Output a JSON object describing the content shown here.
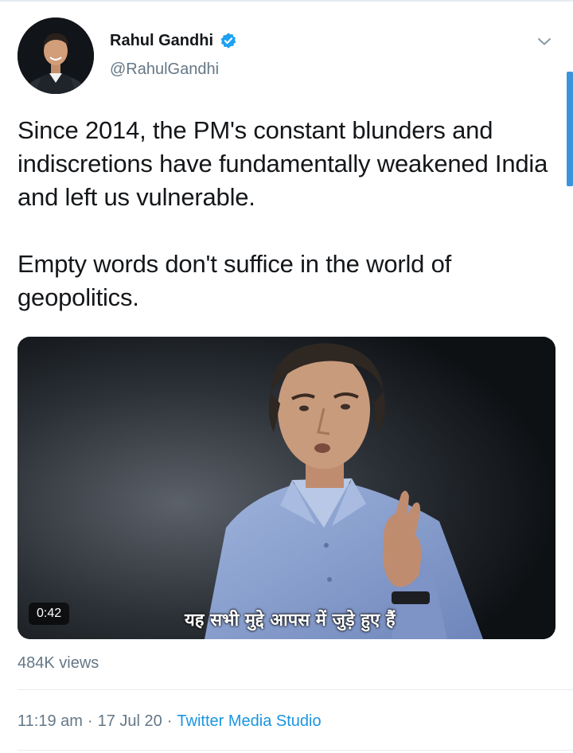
{
  "tweet": {
    "author": {
      "display_name": "Rahul Gandhi",
      "handle": "@RahulGandhi",
      "verified": true
    },
    "text_paragraphs": [
      "Since 2014, the PM's constant blunders and indiscretions have fundamentally weakened India and left us vulnerable.",
      "Empty words don't suffice in the world of geopolitics."
    ],
    "media": {
      "type": "video",
      "duration": "0:42",
      "subtitle": "यह सभी मुद्दे आपस में जुड़े हुए हैं"
    },
    "views": "484K views",
    "time": "11:19 am",
    "date": "17 Jul 20",
    "separator": "·",
    "source": "Twitter Media Studio"
  },
  "icons": {
    "verified": "verified-badge-icon",
    "more": "chevron-down-icon"
  },
  "colors": {
    "text_primary": "#14171a",
    "text_secondary": "#657786",
    "link": "#1b95e0",
    "verified": "#1da1f2"
  }
}
